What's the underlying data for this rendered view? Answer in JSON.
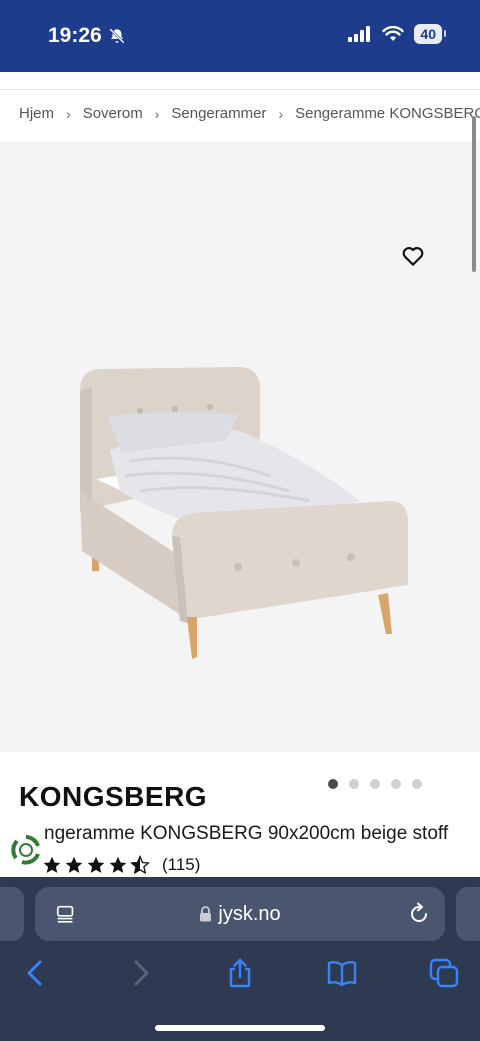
{
  "status": {
    "time": "19:26",
    "battery": "40"
  },
  "breadcrumb": [
    "Hjem",
    "Soverom",
    "Sengerammer",
    "Sengeramme KONGSBERG"
  ],
  "gallery": {
    "dot_count": 5,
    "active_index": 0
  },
  "product": {
    "title": "KONGSBERG",
    "subtitle": "ngeramme KONGSBERG 90x200cm beige stoff",
    "rating": 4.5,
    "review_count": "(115)"
  },
  "browser": {
    "url": "jysk.no"
  },
  "icons": {
    "wishlist": "heart-outline-icon",
    "reader": "reader-mode-icon",
    "reload": "reload-icon",
    "back": "chevron-left-icon",
    "forward": "chevron-right-icon",
    "share": "share-icon",
    "bookmarks": "book-icon",
    "tabs": "tabs-icon",
    "lock": "lock-icon",
    "recycle": "recycle-badge-icon"
  },
  "colors": {
    "brand": "#1e3c8c",
    "safari_bar": "#2d3a52",
    "link_blue": "#3a82f7"
  }
}
